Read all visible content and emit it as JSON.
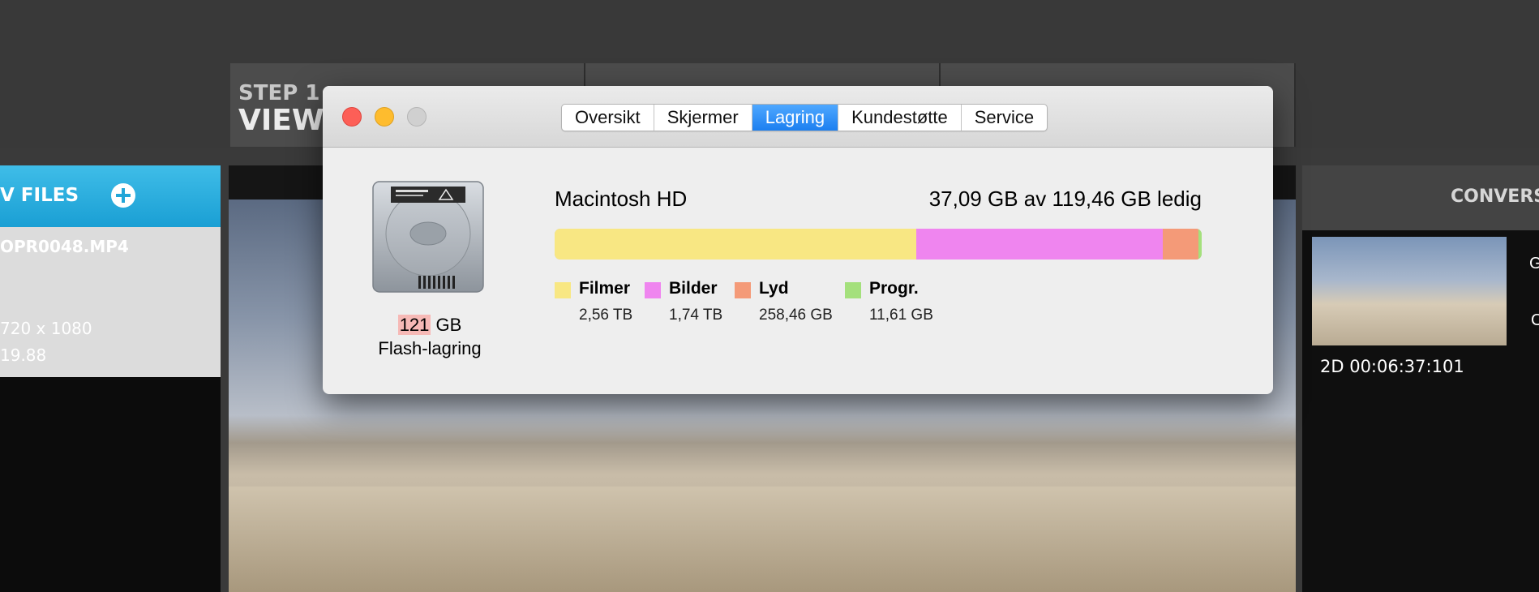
{
  "background_app": {
    "steps": [
      {
        "number": "STEP 1",
        "name": "VIEW &"
      },
      {
        "number": "",
        "name": ""
      },
      {
        "number": "",
        "name": ""
      }
    ],
    "files_panel": {
      "title": "V FILES",
      "file": {
        "name": "OPR0048.MP4",
        "resolution": "720 x 1080",
        "fps": "19.88"
      }
    },
    "conversion_panel": {
      "title": "CONVERSI",
      "timecode": "2D 00:06:37:101",
      "cut_label_g": "G",
      "cut_label_c": "C"
    }
  },
  "dialog": {
    "tabs": [
      {
        "label": "Oversikt",
        "active": false
      },
      {
        "label": "Skjermer",
        "active": false
      },
      {
        "label": "Lagring",
        "active": true
      },
      {
        "label": "Kundestøtte",
        "active": false
      },
      {
        "label": "Service",
        "active": false
      }
    ],
    "disk": {
      "size_number": "121",
      "size_unit": " GB",
      "kind": "Flash-lagring"
    },
    "volume": {
      "name": "Macintosh HD",
      "free_text": "37,09 GB av 119,46 GB ledig"
    },
    "usage_bar_fraction": [
      {
        "category": "Filmer",
        "fraction": 0.559,
        "color": "#f8e783"
      },
      {
        "category": "Bilder",
        "fraction": 0.381,
        "color": "#ef85ef"
      },
      {
        "category": "Lyd",
        "fraction": 0.055,
        "color": "#f49a78"
      },
      {
        "category": "Progr.",
        "fraction": 0.005,
        "color": "#a4e07c"
      }
    ],
    "legend": [
      {
        "label": "Filmer",
        "size": "2,56 TB",
        "color": "#f8e783"
      },
      {
        "label": "Bilder",
        "size": "1,74 TB",
        "color": "#ef85ef"
      },
      {
        "label": "Lyd",
        "size": "258,46 GB",
        "color": "#f49a78"
      },
      {
        "label": "Progr.",
        "size": "11,61 GB",
        "color": "#a4e07c"
      }
    ]
  }
}
